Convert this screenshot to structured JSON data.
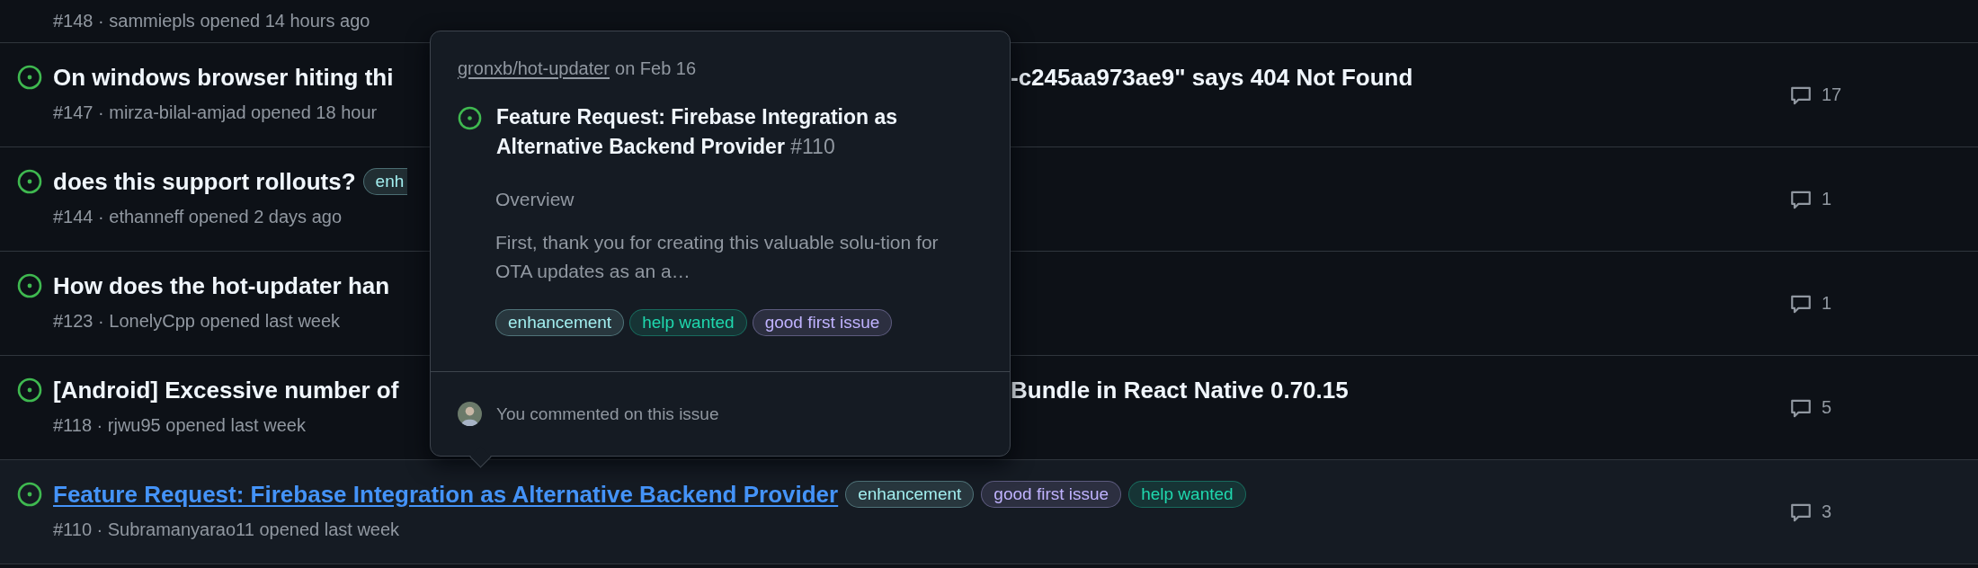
{
  "issues": [
    {
      "meta": "#148 · sammiepls opened 14 hours ago"
    },
    {
      "title": "On windows browser hiting thi",
      "title_after": "-c245aa973ae9\" says 404 Not Found",
      "covered": true,
      "meta": "#147 · mirza-bilal-amjad opened 18 hour",
      "comments": "17",
      "hovered": false
    },
    {
      "title": "does this support rollouts?",
      "labels": [
        {
          "text": "enh",
          "color": "#a2eeef"
        }
      ],
      "covered": true,
      "meta": "#144 · ethanneff opened 2 days ago",
      "comments": "1",
      "hovered": false
    },
    {
      "title": "How does the hot-updater han",
      "meta": "#123 · LonelyCpp opened last week",
      "comments": "1",
      "hovered": false
    },
    {
      "title": "[Android] Excessive number of",
      "title_after": "Bundle in React Native 0.70.15",
      "covered": true,
      "meta": "#118 · rjwu95 opened last week",
      "comments": "5",
      "hovered": false
    },
    {
      "title": "Feature Request: Firebase Integration as Alternative Backend Provider",
      "labels": [
        {
          "text": "enhancement",
          "color": "#a2eeef"
        },
        {
          "text": "good first issue",
          "color": "#c0b3ff"
        },
        {
          "text": "help wanted",
          "color": "#1fd8ae"
        }
      ],
      "covered": false,
      "meta": "#110 · Subramanyarao11 opened last week",
      "comments": "3",
      "hovered": true
    }
  ],
  "popover": {
    "repo": "gronxb/hot-updater",
    "date": "on Feb 16",
    "title": "Feature Request: Firebase Integration as Alternative Backend Provider",
    "number": "#110",
    "heading": "Overview",
    "body": "First, thank you for creating this valuable solu-tion for OTA updates as an a…",
    "labels": [
      {
        "text": "enhancement",
        "color": "#a2eeef"
      },
      {
        "text": "help wanted",
        "color": "#1fd8ae"
      },
      {
        "text": "good first issue",
        "color": "#c0b3ff"
      }
    ],
    "footer": "You commented on this issue"
  }
}
